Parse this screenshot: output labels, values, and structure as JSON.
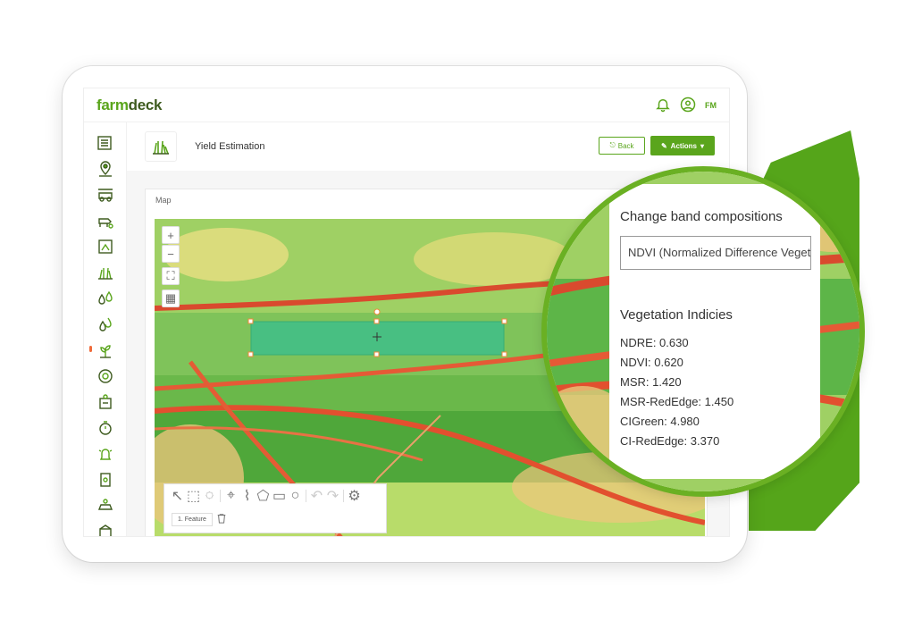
{
  "app": {
    "logo_part1": "farm",
    "logo_part2": "deck",
    "user_initials": "FM"
  },
  "page": {
    "title": "Yield Estimation",
    "back_label": "Back",
    "actions_label": "Actions"
  },
  "map": {
    "label": "Map",
    "zoom_in": "+",
    "zoom_out": "−"
  },
  "draw_tools": {
    "feature_label": "1. Feature"
  },
  "magnifier": {
    "band_title": "Change band compositions",
    "band_select_value": "NDVI (Normalized Difference Vegetation Index)",
    "veg_title": "Vegetation Indicies",
    "indices": [
      {
        "label": "NDRE: 0.630"
      },
      {
        "label": "NDVI: 0.620"
      },
      {
        "label": "MSR: 1.420"
      },
      {
        "label": "MSR-RedEdge: 1.450"
      },
      {
        "label": "CIGreen: 4.980"
      },
      {
        "label": "CI-RedEdge: 3.370"
      }
    ]
  },
  "sidebar": {
    "icons": [
      "list-icon",
      "location-icon",
      "tractor-icon",
      "livestock-icon",
      "crop-area-icon",
      "grass-icon",
      "droplets-icon",
      "droplets-alt-icon",
      "plant-growth-icon",
      "target-icon",
      "weather-station-icon",
      "timer-icon",
      "alert-icon",
      "device-icon",
      "vehicle-icon",
      "storage-icon"
    ]
  },
  "colors": {
    "brand_green": "#5aa51c",
    "dark_green": "#3e5b1f",
    "selection_fill": "#3fbf8a"
  }
}
